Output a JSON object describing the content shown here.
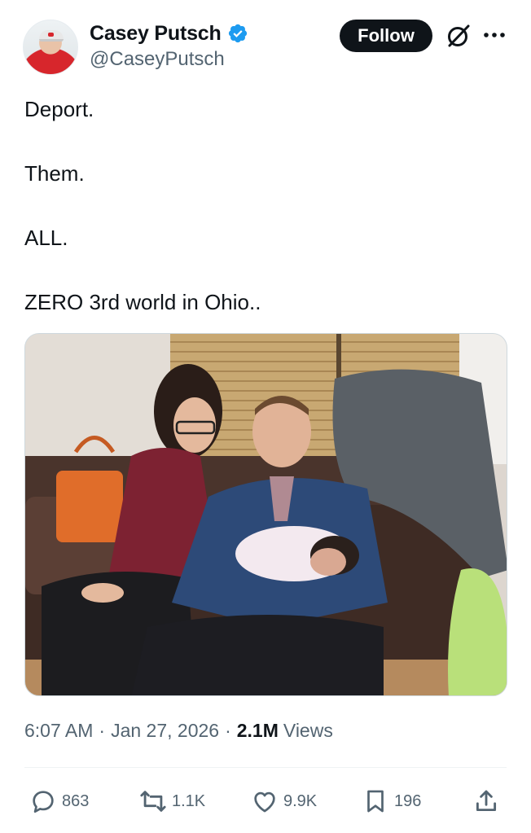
{
  "author": {
    "display_name": "Casey Putsch",
    "handle": "@CaseyPutsch",
    "verified": true
  },
  "header": {
    "follow_label": "Follow",
    "icons": [
      "grok-icon",
      "more-icon",
      "verified-badge-icon"
    ]
  },
  "tweet": {
    "lines": [
      "Deport.",
      "Them.",
      "ALL.",
      "ZERO 3rd world in Ohio.."
    ]
  },
  "media": {
    "kind": "photo"
  },
  "meta": {
    "time": "6:07 AM",
    "date": "Jan 27, 2026",
    "views_count": "2.1M",
    "views_label": "Views",
    "separator": "·"
  },
  "actions": {
    "replies": "863",
    "reposts": "1.1K",
    "likes": "9.9K",
    "bookmarks": "196",
    "icons": [
      "reply-icon",
      "repost-icon",
      "like-icon",
      "bookmark-icon",
      "share-icon"
    ]
  },
  "colors": {
    "text": "#0f1419",
    "secondary": "#536471",
    "verified": "#1d9bf0",
    "follow_bg": "#0f1419"
  }
}
